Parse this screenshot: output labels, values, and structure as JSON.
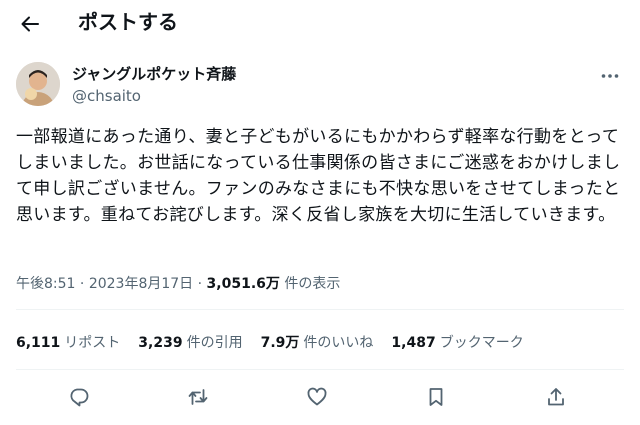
{
  "header": {
    "title": "ポストする"
  },
  "author": {
    "name": "ジャングルポケット斉藤",
    "handle": "@chsaito"
  },
  "tweet": {
    "text": "一部報道にあった通り、妻と子どもがいるにもかかわらず軽率な行動をとってしまいました。お世話になっている仕事関係の皆さまにご迷惑をおかけしまして申し訳ございません。ファンのみなさまにも不快な思いをさせてしまったと思います。重ねてお詫びします。深く反省し家族を大切に生活していきます。"
  },
  "meta": {
    "time": "午後8:51",
    "sep1": " · ",
    "date": "2023年8月17日",
    "sep2": " · ",
    "views": "3,051.6万",
    "views_label": " 件の表示"
  },
  "stats": {
    "reposts": {
      "num": "6,111",
      "label": "リポスト"
    },
    "quotes": {
      "num": "3,239",
      "label": "件の引用"
    },
    "likes": {
      "num": "7.9万",
      "label": "件のいいね"
    },
    "bookmarks": {
      "num": "1,487",
      "label": "ブックマーク"
    }
  },
  "icons": {
    "back": "back-arrow-icon",
    "more": "more-icon",
    "reply": "reply-icon",
    "repost": "repost-icon",
    "like": "heart-icon",
    "bookmark": "bookmark-icon",
    "share": "share-icon"
  },
  "colors": {
    "text": "#0f1419",
    "secondary": "#536471",
    "divider": "#eff3f4"
  }
}
